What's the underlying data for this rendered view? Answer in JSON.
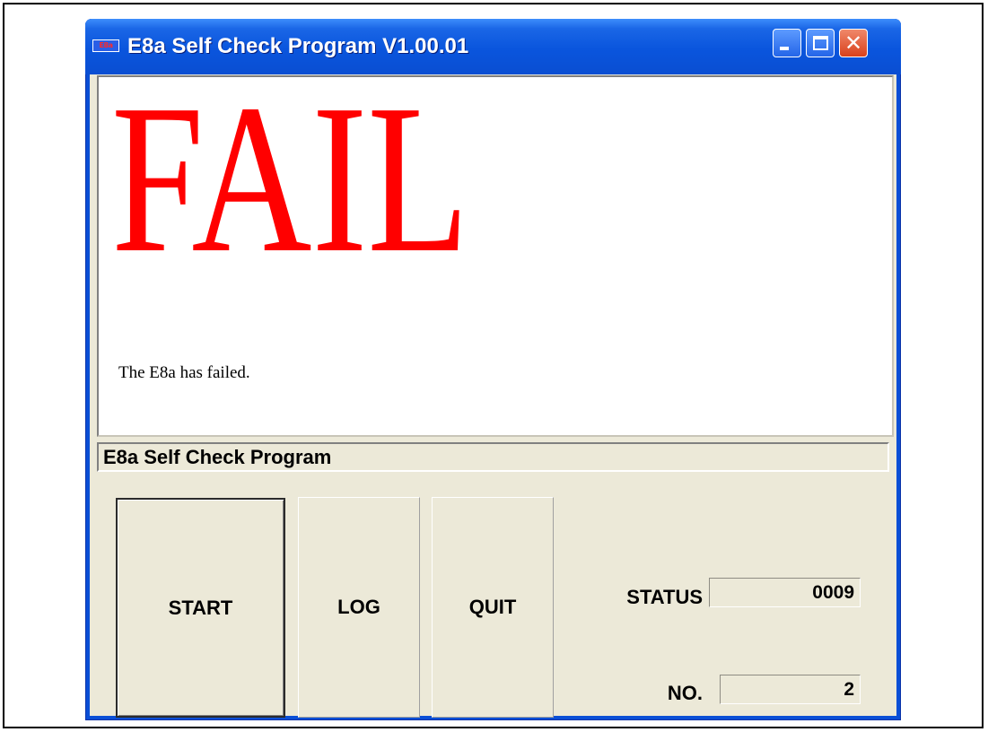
{
  "window": {
    "title": "E8a Self Check Program V1.00.01",
    "icon_text": "E8a",
    "icon": "app-icon",
    "controls": {
      "minimize_icon": "minimize-icon",
      "maximize_icon": "maximize-icon",
      "close_icon": "close-icon",
      "close_glyph": "✕"
    }
  },
  "result": {
    "headline": "FAIL",
    "message": "The E8a has failed.",
    "headline_color": "#ff0000"
  },
  "caption": "E8a Self Check Program",
  "buttons": {
    "start": "START",
    "log": "LOG",
    "quit": "QUIT"
  },
  "fields": {
    "status_label": "STATUS",
    "status_value": "0009",
    "no_label": "NO.",
    "no_value": "2"
  },
  "colors": {
    "titlebar": "#0a55dd",
    "window_face": "#ece9d8",
    "close_button": "#d9411c"
  }
}
